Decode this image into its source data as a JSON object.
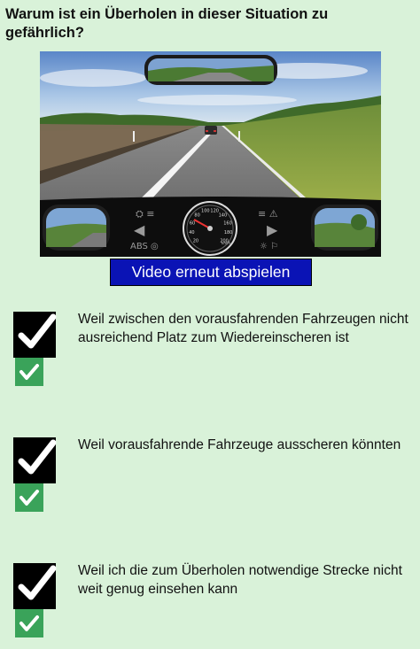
{
  "question": {
    "text": "Warum ist ein Überholen in dieser Situation zu gefährlich?"
  },
  "video": {
    "description_icon": "driving-scene-image",
    "replay_label": "Video erneut abspielen",
    "speedometer_labels": [
      "20",
      "40",
      "60",
      "80",
      "100",
      "120",
      "140",
      "160",
      "180",
      "200"
    ],
    "speed_unit": "km/h"
  },
  "answers": [
    {
      "text": "Weil zwischen den vorausfahrenden Fahrzeugen nicht ausreichend Platz zum Wiedereinscheren ist",
      "user_checked": true,
      "correct": true
    },
    {
      "text": "Weil vorausfahrende Fahrzeuge ausscheren könnten",
      "user_checked": true,
      "correct": true
    },
    {
      "text": "Weil ich die zum Überholen notwendige Strecke nicht weit genug einsehen kann",
      "user_checked": true,
      "correct": true
    }
  ],
  "colors": {
    "background": "#d9f2d9",
    "replay_button": "#0a13b5",
    "correct_badge": "#3aa35a",
    "checkbox": "#000000"
  }
}
